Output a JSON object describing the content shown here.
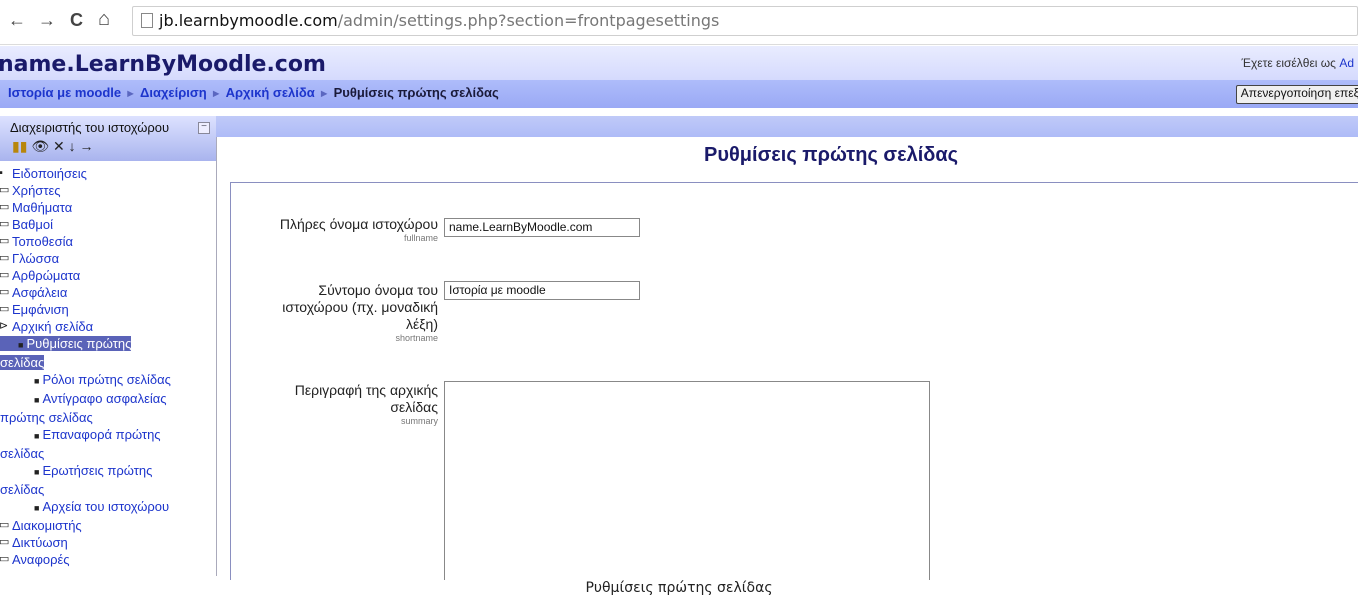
{
  "browser": {
    "url_domain": "jb.learnbymoodle.com",
    "url_path": "/admin/settings.php?section=frontpagesettings",
    "back_glyph": "←",
    "forward_glyph": "→",
    "reload_glyph": "C",
    "home_glyph": "⌂"
  },
  "header": {
    "site_name": "name.LearnByMoodle.com",
    "login_text": "Έχετε εισέλθει ως",
    "login_user": "Ad"
  },
  "navbar": {
    "crumbs": [
      "Ιστορία με moodle",
      "Διαχείριση",
      "Αρχική σελίδα",
      "Ρυθμίσεις πρώτης σελίδας"
    ],
    "separator": "►",
    "logout_label": "Απενεργοποίηση επεξ"
  },
  "sidebar": {
    "title": "Διαχειριστής του ιστοχώρου",
    "collapse_glyph": "−",
    "tool_icons": "✕ ↓ →",
    "items": [
      {
        "label": "Ειδοποιήσεις",
        "icon": "bullet"
      },
      {
        "label": "Χρήστες",
        "icon": "folder"
      },
      {
        "label": "Μαθήματα",
        "icon": "folder"
      },
      {
        "label": "Βαθμοί",
        "icon": "folder"
      },
      {
        "label": "Τοποθεσία",
        "icon": "folder"
      },
      {
        "label": "Γλώσσα",
        "icon": "folder"
      },
      {
        "label": "Αρθρώματα",
        "icon": "folder"
      },
      {
        "label": "Ασφάλεια",
        "icon": "folder"
      },
      {
        "label": "Εμφάνιση",
        "icon": "folder"
      },
      {
        "label": "Αρχική σελίδα",
        "icon": "folder-open"
      }
    ],
    "subitems": [
      {
        "line1": "Ρυθμίσεις πρώτης",
        "line2": "σελίδας",
        "selected": true
      },
      {
        "line1": "Ρόλοι πρώτης σελίδας",
        "line2": ""
      },
      {
        "line1": "Αντίγραφο ασφαλείας",
        "line2": "πρώτης σελίδας"
      },
      {
        "line1": "Επαναφορά πρώτης",
        "line2": "σελίδας"
      },
      {
        "line1": "Ερωτήσεις πρώτης",
        "line2": "σελίδας"
      },
      {
        "line1": "Αρχεία του ιστοχώρου",
        "line2": ""
      }
    ],
    "items_after": [
      {
        "label": "Διακομιστής",
        "icon": "folder"
      },
      {
        "label": "Δικτύωση",
        "icon": "folder"
      },
      {
        "label": "Αναφορές",
        "icon": "folder"
      }
    ]
  },
  "main": {
    "heading": "Ρυθμίσεις πρώτης σελίδας",
    "fields": [
      {
        "label": "Πλήρες όνομα ιστοχώρου",
        "key": "fullname",
        "value": "name.LearnByMoodle.com"
      },
      {
        "label_lines": [
          "Σύντομο όνομα του",
          "ιστοχώρου (πχ. μοναδική",
          "λέξη)"
        ],
        "key": "shortname",
        "value": "Ιστορία με moodle"
      },
      {
        "label_lines": [
          "Περιγραφή της αρχικής",
          "σελίδας"
        ],
        "key": "summary",
        "value": ""
      }
    ]
  },
  "caption": "Ρυθμίσεις πρώτης σελίδας"
}
